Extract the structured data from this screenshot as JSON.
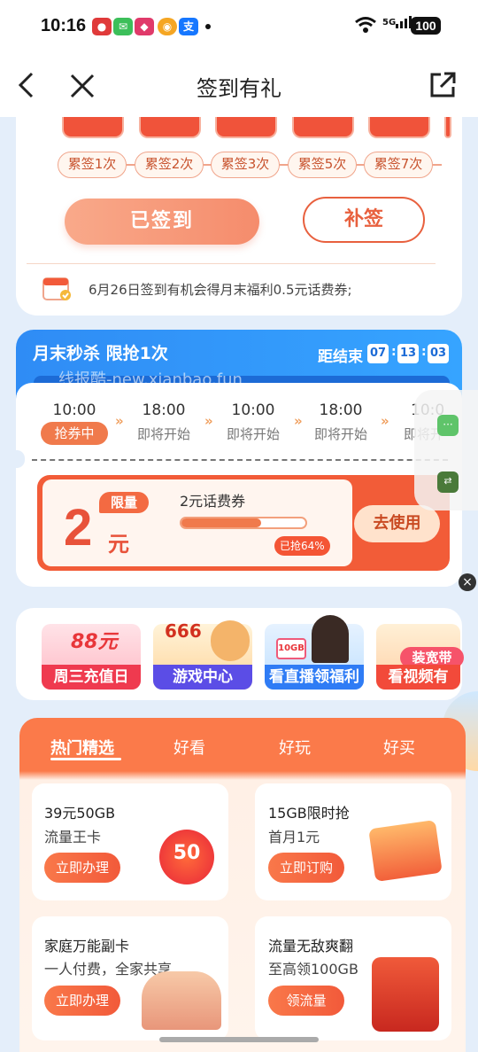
{
  "status": {
    "time": "10:16",
    "battery": "100",
    "network": "5G"
  },
  "nav": {
    "title": "签到有礼"
  },
  "signin": {
    "milestones": [
      "累签1次",
      "累签2次",
      "累签3次",
      "累签5次",
      "累签7次"
    ],
    "signed_label": "已签到",
    "makeup_label": "补签",
    "tip": "6月26日签到有机会得月末福利0.5元话费券;"
  },
  "flash": {
    "title": "月末秒杀  限抢1次",
    "countdown_label": "距结束",
    "countdown": [
      "07",
      "13",
      "03"
    ],
    "watermark": "线报酷-new.xianbao.fun",
    "timeline": [
      {
        "time": "10:00",
        "status": "抢券中"
      },
      {
        "time": "18:00",
        "status": "即将开始"
      },
      {
        "time": "10:00",
        "status": "即将开始"
      },
      {
        "time": "18:00",
        "status": "即将开始"
      },
      {
        "time": "10:0",
        "status": "即将开"
      }
    ],
    "coupon": {
      "amount": "2",
      "unit": "元",
      "tag": "限量",
      "name": "2元话费券",
      "progress": 0.64,
      "progress_label": "已抢64%",
      "use_label": "去使用"
    }
  },
  "entries": [
    {
      "label": "周三充值日",
      "badge": "88元"
    },
    {
      "label": "游戏中心",
      "badge": "666"
    },
    {
      "label": "看直播领福利",
      "badge": "10GB"
    },
    {
      "label": "看视频有",
      "badge": "装宽带"
    }
  ],
  "tabs": [
    "热门精选",
    "好看",
    "好玩",
    "好买"
  ],
  "products": [
    {
      "title": "39元50GB",
      "sub": "流量王卡",
      "btn": "立即办理",
      "badge": "50"
    },
    {
      "title": "15GB限时抢",
      "sub": "首月1元",
      "btn": "立即订购"
    },
    {
      "title": "家庭万能副卡",
      "sub": "一人付费，全家共享",
      "btn": "立即办理"
    },
    {
      "title": "流量无敌爽翻",
      "sub": "至高领100GB",
      "btn": "领流量"
    }
  ],
  "colors": {
    "accent": "#f25a3a",
    "blue": "#2f8cf5"
  }
}
